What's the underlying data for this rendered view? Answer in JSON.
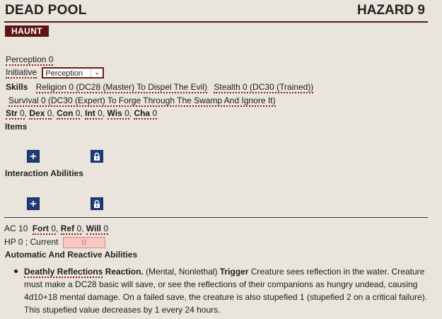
{
  "header": {
    "name": "DEAD POOL",
    "level": "HAZARD 9"
  },
  "trait": "HAUNT",
  "perception": {
    "label": "Perception",
    "value": "0"
  },
  "initiative": {
    "label": "Initiative",
    "selected": "Perception"
  },
  "skills": {
    "label": "Skills",
    "items": [
      "Religion 0 (DC28 (Master) To Dispel The Evil)",
      "Stealth 0 (DC30 (Trained))",
      "Survival 0 (DC30 (Expert) To Forge Through The Swamp And Ignore It)"
    ]
  },
  "abilities": [
    {
      "label": "Str",
      "value": "0"
    },
    {
      "label": "Dex",
      "value": "0"
    },
    {
      "label": "Con",
      "value": "0"
    },
    {
      "label": "Int",
      "value": "0"
    },
    {
      "label": "Wis",
      "value": "0"
    },
    {
      "label": "Cha",
      "value": "0"
    }
  ],
  "sections": {
    "items": "Items",
    "interaction": "Interaction Abilities",
    "automatic": "Automatic And Reactive Abilities"
  },
  "defense": {
    "ac_label": "AC",
    "ac_value": "10",
    "fort_label": "Fort",
    "fort_value": "0",
    "ref_label": "Ref",
    "ref_value": "0",
    "will_label": "Will",
    "will_value": "0"
  },
  "hp": {
    "label": "HP",
    "value": "0",
    "current_label": "Current",
    "current_value": "0"
  },
  "reaction": {
    "name": "Deathly Reflections",
    "type": "Reaction.",
    "traits": "(Mental, Nonlethal)",
    "trigger_label": "Trigger",
    "text1": "Creature sees reflection in the water.",
    "text2": "Creature must make a DC28 basic will save, or see the reflections of their companions as hungry undead, causing 4d10+18 mental damage. On a failed save, the creature is also stupefied 1 (stupefied 2 on a critical failure). This stupefied value decreases by 1 every 24 hours."
  },
  "icons": {
    "add": "plus-icon",
    "lock": "lock-icon"
  },
  "colors": {
    "accent": "#5c1414",
    "button": "#1d3b78",
    "background": "#e9e5dc"
  }
}
